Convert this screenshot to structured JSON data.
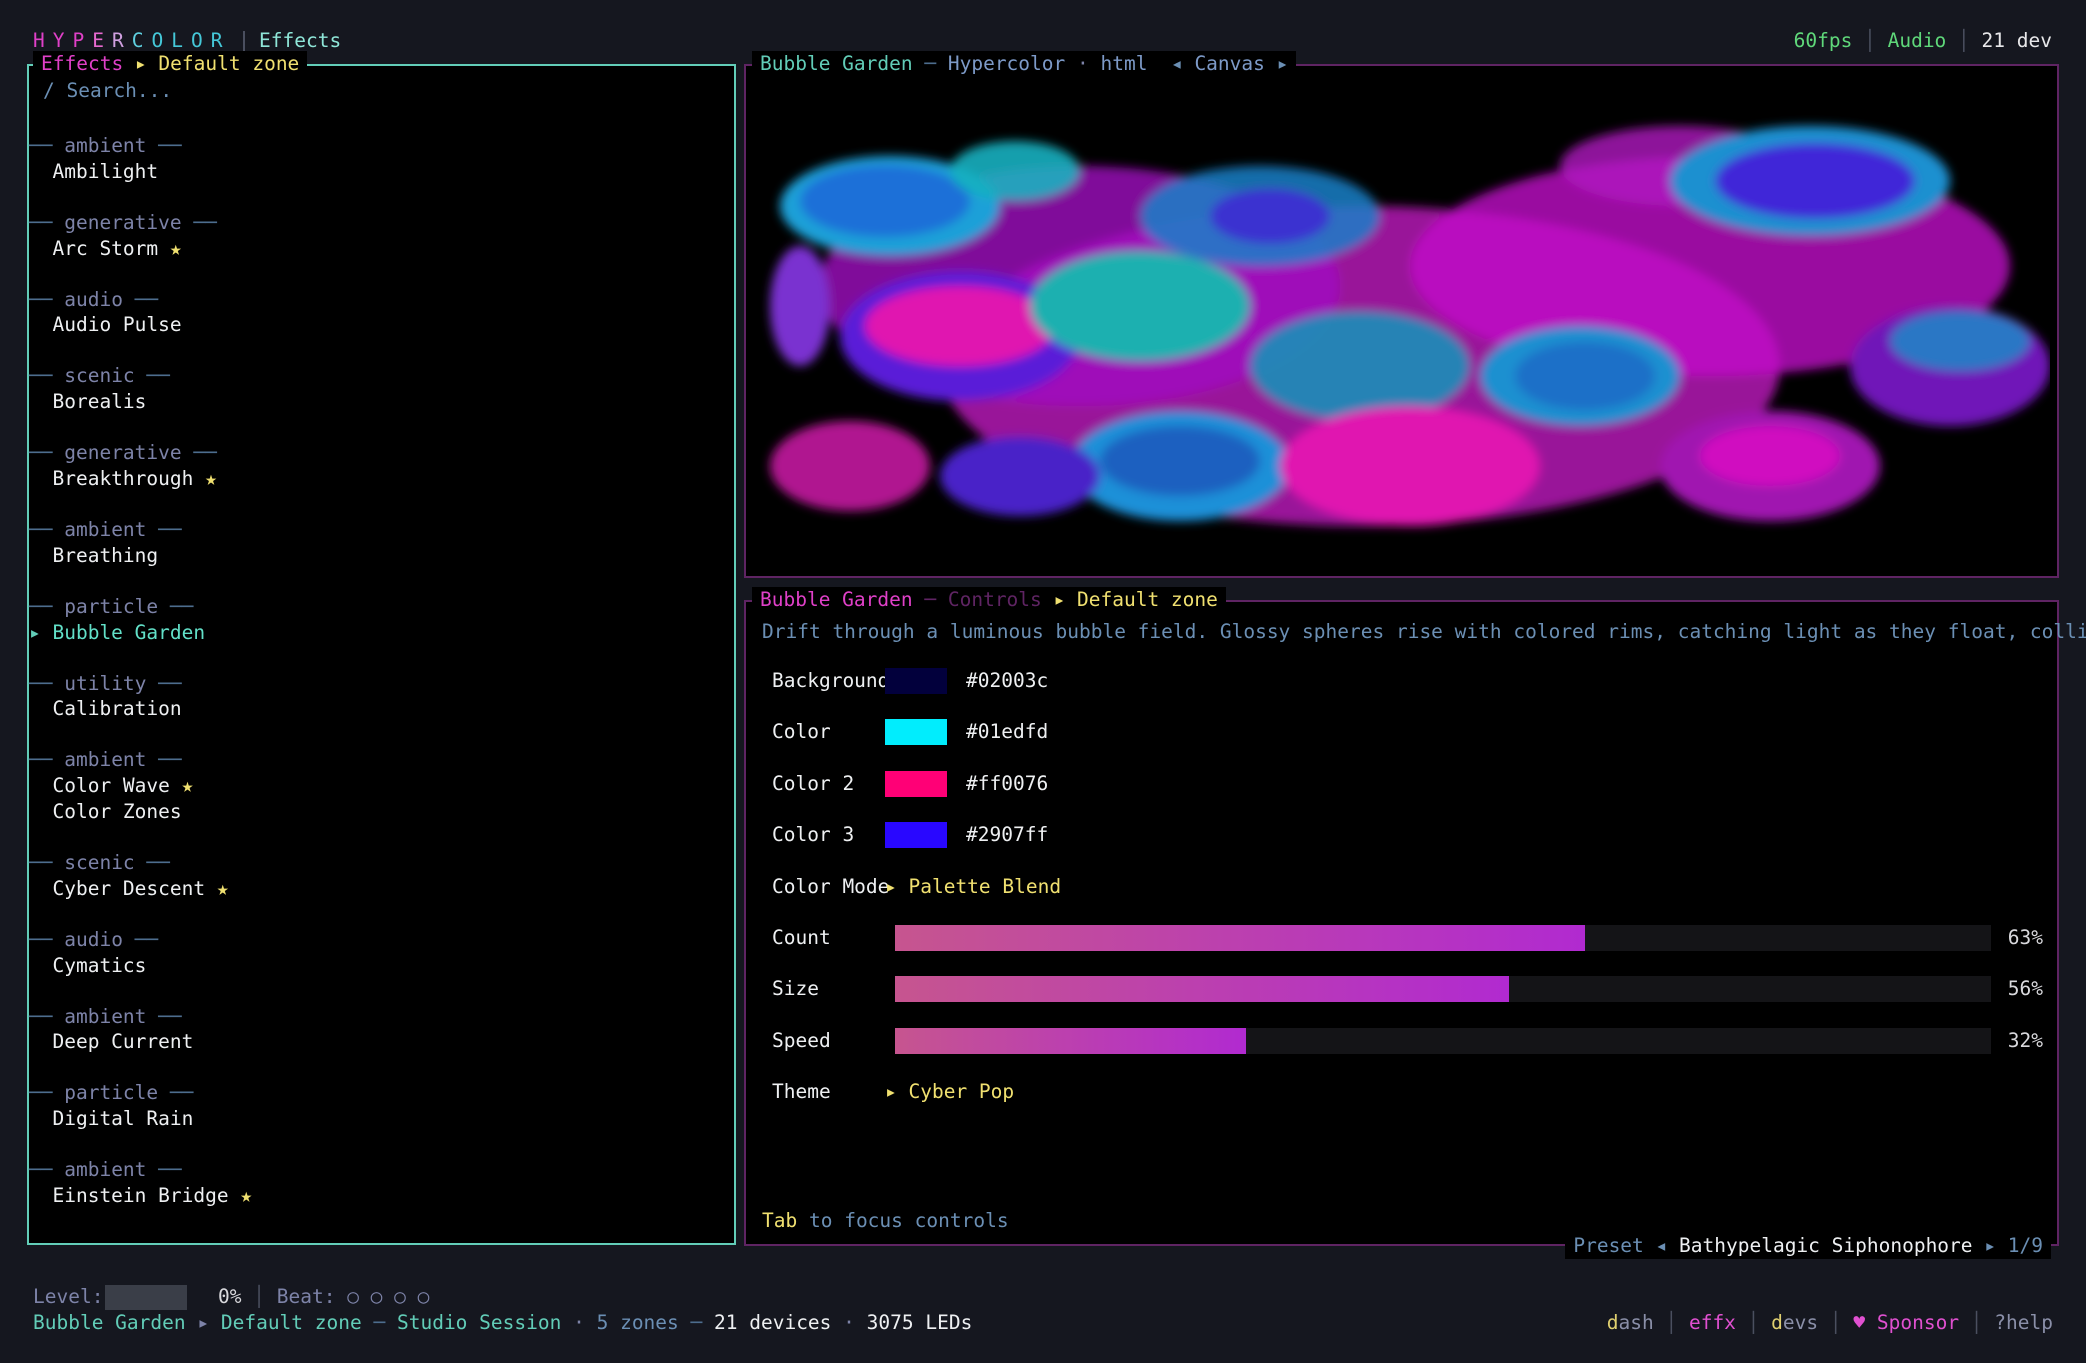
{
  "topbar": {
    "brand": [
      {
        "ch": "H",
        "color": "#e040c8"
      },
      {
        "ch": "Y",
        "color": "#e040c8"
      },
      {
        "ch": "P",
        "color": "#e040c8"
      },
      {
        "ch": "E",
        "color": "#e86ad0"
      },
      {
        "ch": "R",
        "color": "#d0a0e0"
      },
      {
        "ch": "C",
        "color": "#5fd0e0"
      },
      {
        "ch": "O",
        "color": "#45c8d8"
      },
      {
        "ch": "L",
        "color": "#45c8d8"
      },
      {
        "ch": "O",
        "color": "#45c8d8"
      },
      {
        "ch": "R",
        "color": "#45c8d8"
      }
    ],
    "view": "Effects",
    "fps": "60fps",
    "audio": "Audio",
    "devices": "21 dev"
  },
  "effects_panel": {
    "title": "Effects",
    "zone": "Default zone",
    "search_placeholder": "/ Search...",
    "groups": [
      {
        "category": "ambient",
        "items": [
          {
            "name": "Ambilight",
            "fav": false
          }
        ]
      },
      {
        "category": "generative",
        "items": [
          {
            "name": "Arc Storm",
            "fav": true
          }
        ]
      },
      {
        "category": "audio",
        "items": [
          {
            "name": "Audio Pulse",
            "fav": false
          }
        ]
      },
      {
        "category": "scenic",
        "items": [
          {
            "name": "Borealis",
            "fav": false
          }
        ]
      },
      {
        "category": "generative",
        "items": [
          {
            "name": "Breakthrough",
            "fav": true
          }
        ]
      },
      {
        "category": "ambient",
        "items": [
          {
            "name": "Breathing",
            "fav": false
          }
        ]
      },
      {
        "category": "particle",
        "items": [
          {
            "name": "Bubble Garden",
            "fav": false,
            "selected": true
          }
        ]
      },
      {
        "category": "utility",
        "items": [
          {
            "name": "Calibration",
            "fav": false
          }
        ]
      },
      {
        "category": "ambient",
        "items": [
          {
            "name": "Color Wave",
            "fav": true
          },
          {
            "name": "Color Zones",
            "fav": false
          }
        ]
      },
      {
        "category": "scenic",
        "items": [
          {
            "name": "Cyber Descent",
            "fav": true
          }
        ]
      },
      {
        "category": "audio",
        "items": [
          {
            "name": "Cymatics",
            "fav": false
          }
        ]
      },
      {
        "category": "ambient",
        "items": [
          {
            "name": "Deep Current",
            "fav": false
          }
        ]
      },
      {
        "category": "particle",
        "items": [
          {
            "name": "Digital Rain",
            "fav": false
          }
        ]
      },
      {
        "category": "ambient",
        "items": [
          {
            "name": "Einstein Bridge",
            "fav": true
          }
        ]
      }
    ],
    "star": "★",
    "cursor": "▸"
  },
  "preview": {
    "effect": "Bubble Garden",
    "source": "Hypercolor",
    "format": "html",
    "mode": "Canvas"
  },
  "controls": {
    "effect": "Bubble Garden",
    "title": "Controls",
    "zone": "Default zone",
    "description": "Drift through a luminous bubble field. Glossy spheres rise with colored rims, catching light as they float, collide, and",
    "colors": [
      {
        "label": "Background",
        "hex": "#02003c"
      },
      {
        "label": "Color",
        "hex": "#01edfd"
      },
      {
        "label": "Color 2",
        "hex": "#ff0076"
      },
      {
        "label": "Color 3",
        "hex": "#2907ff"
      }
    ],
    "color_mode": {
      "label": "Color Mode",
      "value": "Palette Blend"
    },
    "sliders": [
      {
        "label": "Count",
        "value": 63,
        "display": "63%"
      },
      {
        "label": "Size",
        "value": 56,
        "display": "56%"
      },
      {
        "label": "Speed",
        "value": 32,
        "display": "32%"
      }
    ],
    "theme": {
      "label": "Theme",
      "value": "Cyber Pop"
    },
    "hint_key": "Tab",
    "hint_text": "to focus controls",
    "preset_label": "Preset",
    "preset_name": "Bathypelagic Siphonophore",
    "preset_index": "1/9"
  },
  "statusbar": {
    "level_label": "Level:",
    "level_value": "0%",
    "beat_label": "Beat:",
    "beat_dots": "○ ○ ○ ○",
    "effect": "Bubble Garden",
    "zone": "Default zone",
    "session": "Studio Session",
    "zones": "5 zones",
    "devices": "21 devices",
    "leds": "3075 LEDs",
    "nav": [
      {
        "key": "d",
        "rest": "ash",
        "color": "#e0d070"
      },
      {
        "key": "e",
        "rest": "ffx",
        "color": "#e050d0"
      },
      {
        "key": "d",
        "rest": "evs",
        "color": "#e0d070"
      }
    ],
    "sponsor": "Sponsor",
    "heart": "♥",
    "help": "?help"
  },
  "colors": {
    "magenta": "#e040c8",
    "teal": "#62cdb8",
    "yellow": "#f0e070",
    "muted": "#7d83a8"
  }
}
